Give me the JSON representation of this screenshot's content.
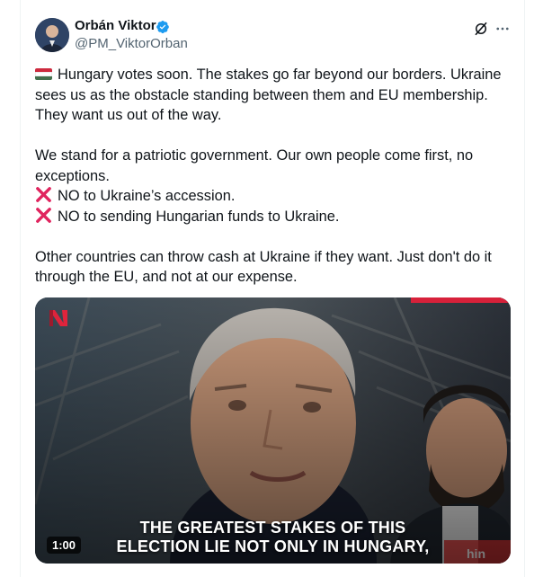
{
  "author": {
    "name": "Orbán Viktor",
    "handle": "@PM_ViktorOrban",
    "verified": true
  },
  "icons": {
    "verified": "verified-badge-icon",
    "grok": "grok-icon",
    "more": "more-options-icon",
    "flag": "hungary-flag-icon",
    "cross": "red-cross-mark-icon",
    "channel_logo": "red-channel-logo-icon"
  },
  "colors": {
    "verified": "#1d9bf0",
    "text": "#0f1419",
    "secondary": "#536471",
    "cross": "#e0245e",
    "flag_red": "#cd2a3e",
    "flag_green": "#436f4d"
  },
  "post": {
    "lines": {
      "l1": "Hungary votes soon. The stakes go far beyond our borders. Ukraine",
      "l2": "sees us as the obstacle standing between them and EU membership.",
      "l3": "They want us out of the way.",
      "l4": "We stand for a patriotic government. Our own people come first, no",
      "l5": "exceptions.",
      "l6": "NO to Ukraine’s accession.",
      "l7": "NO to sending Hungarian funds to Ukraine.",
      "l8": "Other countries can throw cash at Ukraine if they want. Just don't do it",
      "l9": "through the EU, and not at our expense."
    }
  },
  "video": {
    "caption_line1": "THE GREATEST STAKES OF THIS",
    "caption_line2": "ELECTION LIE NOT ONLY IN HUNGARY,",
    "duration": "1:00",
    "mic_text": "hin"
  }
}
